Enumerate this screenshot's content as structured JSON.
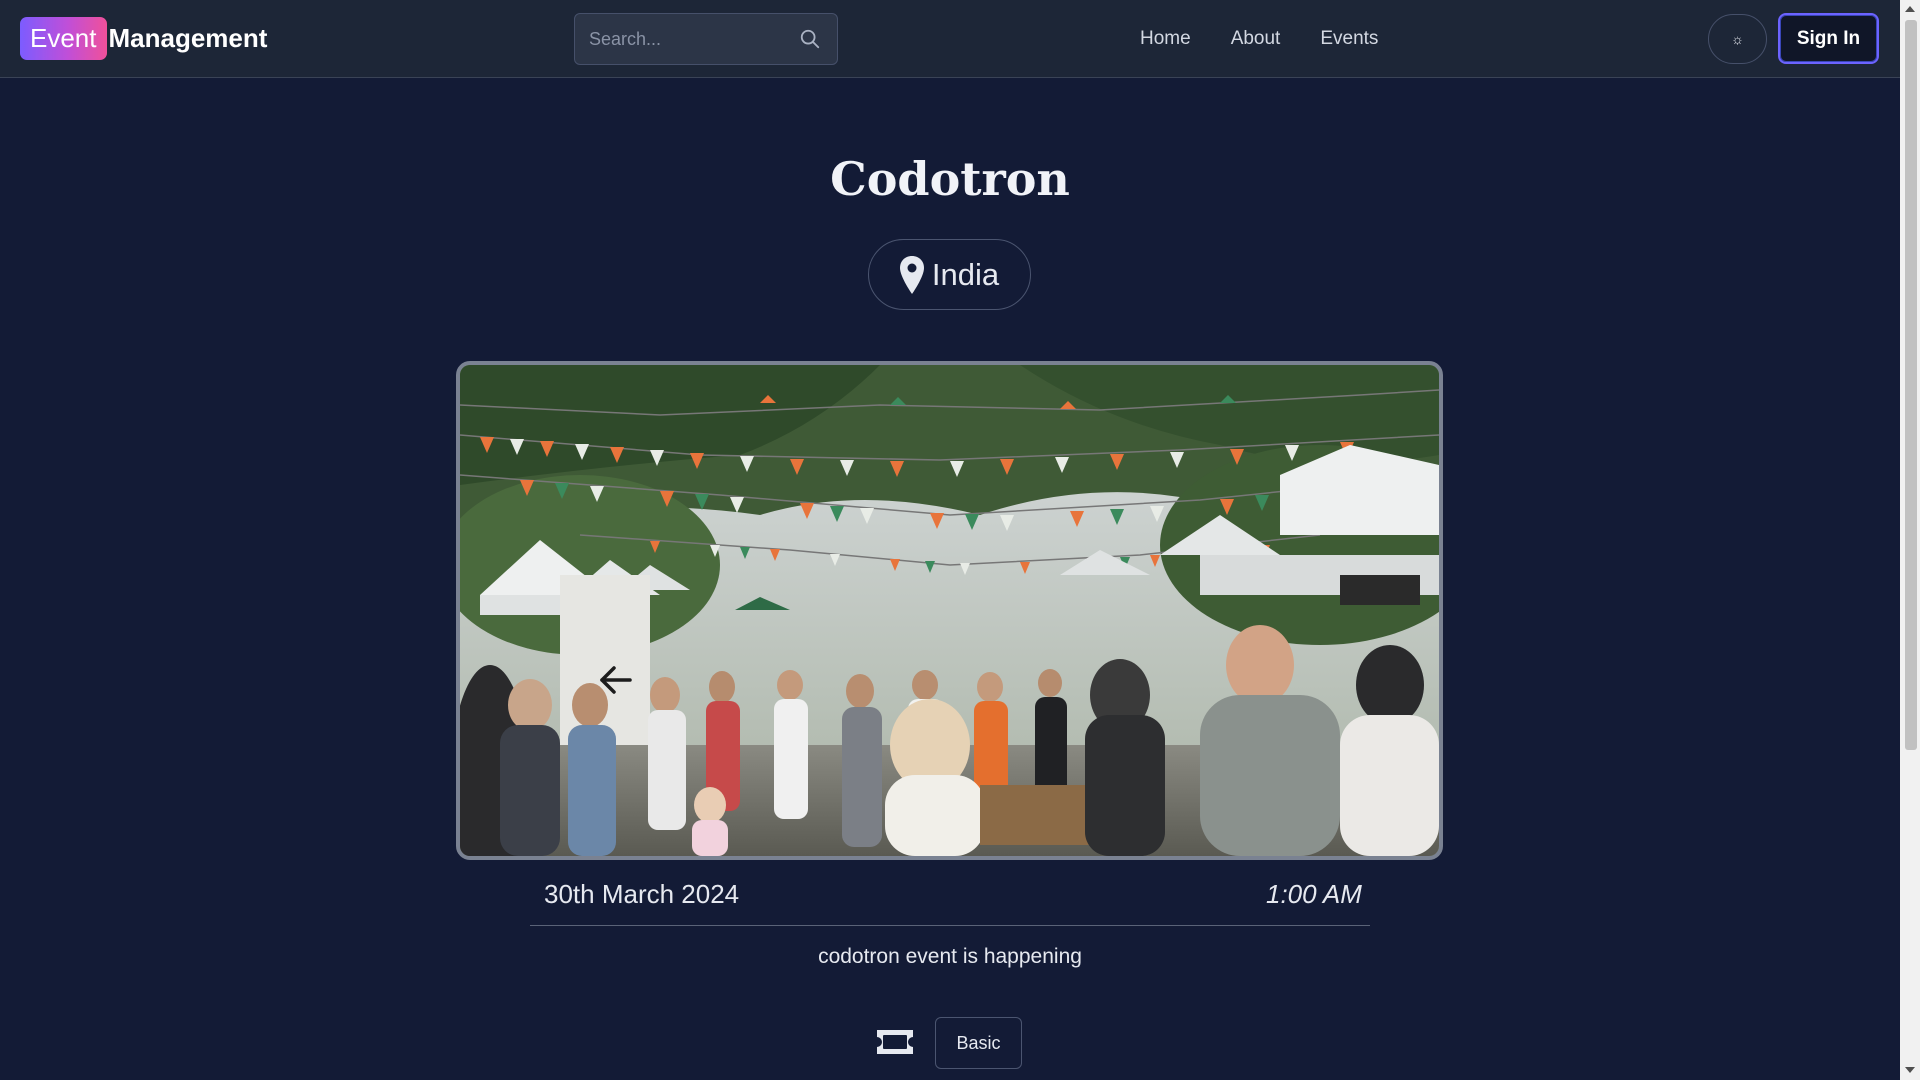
{
  "navbar": {
    "brand_badge": "Event",
    "brand_text": "Management",
    "search_placeholder": "Search...",
    "links": [
      "Home",
      "About",
      "Events"
    ],
    "theme_toggle_glyph": "☼",
    "signin_label": "Sign In"
  },
  "event": {
    "title": "Codotron",
    "location": "India",
    "date": "30th March 2024",
    "time": "1:00 AM",
    "description": "codotron event is happening",
    "ticket_tier": "Basic"
  },
  "icons": {
    "search": "search-icon",
    "location": "map-pin-icon",
    "prev": "arrow-left-icon",
    "ticket": "ticket-icon",
    "theme": "sun-icon"
  },
  "colors": {
    "background": "#131b36",
    "navbar": "#1d2637",
    "brand_gradient_start": "#7c5cff",
    "brand_gradient_end": "#f0509a",
    "signin_border": "#6c63ff"
  }
}
